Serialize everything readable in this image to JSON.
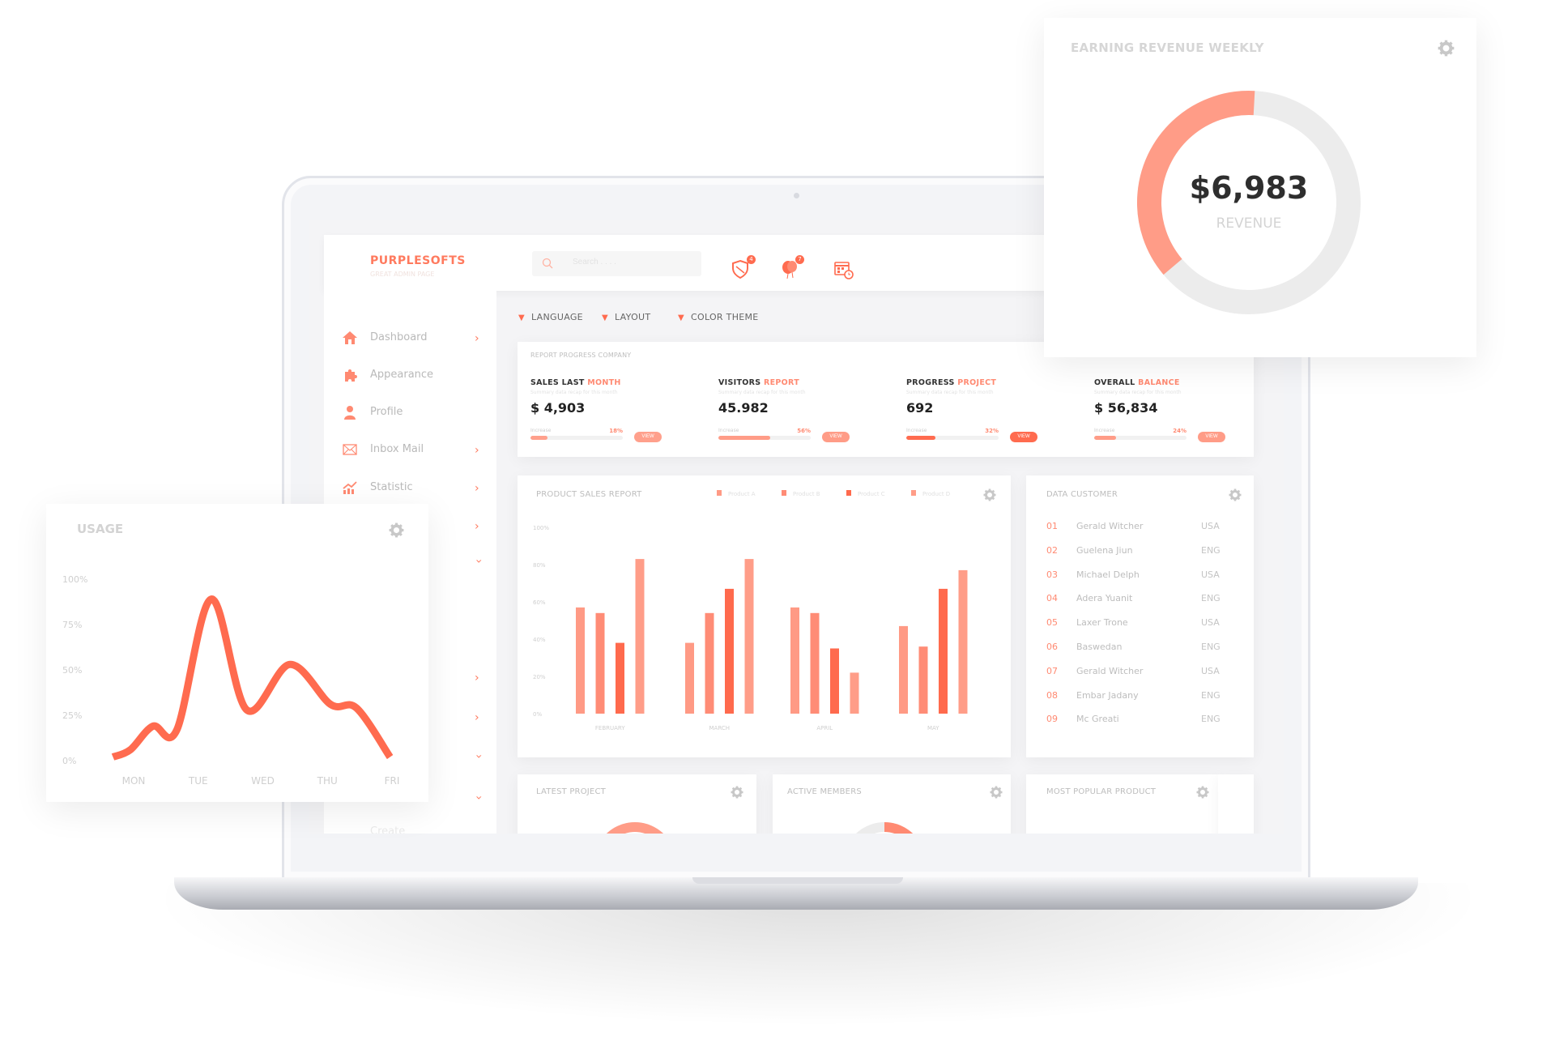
{
  "colors": {
    "accent": "#ff6b4f",
    "accent_light": "#ff9c87",
    "track": "#ececec"
  },
  "header": {
    "logo": "PURPLESOFTS",
    "logo_sub": "GREAT ADMIN PAGE",
    "search_placeholder": "Search . . . .",
    "icons": [
      {
        "name": "shield-icon",
        "badge": "4"
      },
      {
        "name": "balloon-icon",
        "badge": "7"
      },
      {
        "name": "calendar-clock-icon"
      }
    ]
  },
  "sidebar": {
    "items": [
      {
        "label": "Dashboard",
        "icon": "home-icon",
        "chevron": "right"
      },
      {
        "label": "Appearance",
        "icon": "puzzle-icon",
        "chevron": ""
      },
      {
        "label": "Profile",
        "icon": "user-icon",
        "chevron": ""
      },
      {
        "label": "Inbox Mail",
        "icon": "mail-icon",
        "chevron": "right"
      },
      {
        "label": "Statistic",
        "icon": "chart-icon",
        "chevron": "right"
      }
    ],
    "hidden_chevrons": [
      "right",
      "down",
      "right",
      "right",
      "down",
      "down"
    ],
    "bottom_label": "Create"
  },
  "filters": [
    "LANGUAGE",
    "LAYOUT",
    "COLOR THEME"
  ],
  "report": {
    "title": "REPORT PROGRESS COMPANY",
    "stats": [
      {
        "label": "SALES LAST",
        "accent": "MONTH",
        "subtitle": "Summary data recap for this month",
        "value": "$ 4,903",
        "increase_label": "Increase",
        "percent": "18%",
        "progress": 18,
        "button": "VIEW",
        "button_color": "#ffa08c"
      },
      {
        "label": "VISITORS",
        "accent": "REPORT",
        "subtitle": "Summary data recap for this month",
        "value": "45.982",
        "increase_label": "Increase",
        "percent": "56%",
        "progress": 56,
        "button": "VIEW",
        "button_color": "#ff9c87"
      },
      {
        "label": "PROGRESS",
        "accent": "PROJECT",
        "subtitle": "Summary data recap for this month",
        "value": "692",
        "increase_label": "Increase",
        "percent": "32%",
        "progress": 32,
        "button": "VIEW",
        "button_color": "#ff6b4f"
      },
      {
        "label": "OVERALL",
        "accent": "BALANCE",
        "subtitle": "Summary data recap for this month",
        "value": "$ 56,834",
        "increase_label": "Increase",
        "percent": "24%",
        "progress": 24,
        "button": "VIEW",
        "button_color": "#ff9c87"
      }
    ]
  },
  "customers": {
    "title": "DATA CUSTOMER",
    "rows": [
      {
        "no": "01",
        "name": "Gerald Witcher",
        "country": "USA"
      },
      {
        "no": "02",
        "name": "Guelena Jiun",
        "country": "ENG"
      },
      {
        "no": "03",
        "name": "Michael Delph",
        "country": "USA"
      },
      {
        "no": "04",
        "name": "Adera Yuanit",
        "country": "ENG"
      },
      {
        "no": "05",
        "name": "Laxer Trone",
        "country": "USA"
      },
      {
        "no": "06",
        "name": "Baswedan",
        "country": "ENG"
      },
      {
        "no": "07",
        "name": "Gerald Witcher",
        "country": "USA"
      },
      {
        "no": "08",
        "name": "Embar Jadany",
        "country": "ENG"
      },
      {
        "no": "09",
        "name": "Mc Greati",
        "country": "ENG"
      }
    ]
  },
  "bottom_cards": [
    {
      "title": "LATEST PROJECT"
    },
    {
      "title": "ACTIVE MEMBERS"
    },
    {
      "title": "MOST POPULAR PRODUCT"
    }
  ],
  "chart_data": [
    {
      "type": "bar",
      "title": "PRODUCT SALES REPORT",
      "categories": [
        "FEBRUARY",
        "MARCH",
        "APRIL",
        "MAY"
      ],
      "yticks": [
        "0%",
        "20%",
        "40%",
        "60%",
        "80%",
        "100%"
      ],
      "ylim": [
        0,
        100
      ],
      "legend": "top-right",
      "series": [
        {
          "name": "Product A",
          "color": "#ff9a85",
          "values": [
            57,
            38,
            57,
            47
          ]
        },
        {
          "name": "Product B",
          "color": "#ff8c76",
          "values": [
            54,
            54,
            54,
            36
          ]
        },
        {
          "name": "Product C",
          "color": "#ff6a4d",
          "values": [
            38,
            67,
            35,
            67
          ]
        },
        {
          "name": "Product D",
          "color": "#ff9d88",
          "values": [
            83,
            83,
            22,
            77
          ]
        }
      ]
    },
    {
      "type": "line",
      "title": "USAGE",
      "categories": [
        "MON",
        "TUE",
        "WED",
        "THU",
        "FRI"
      ],
      "yticks": [
        "0%",
        "25%",
        "50%",
        "75%",
        "100%"
      ],
      "ylim": [
        0,
        100
      ],
      "color": "#ff6b4f",
      "points": [
        [
          -0.32,
          2
        ],
        [
          -0.05,
          6
        ],
        [
          0.3,
          19
        ],
        [
          0.67,
          17
        ],
        [
          1.2,
          89
        ],
        [
          1.75,
          28
        ],
        [
          2.42,
          53
        ],
        [
          3.05,
          31
        ],
        [
          3.45,
          29
        ],
        [
          3.97,
          2
        ]
      ]
    },
    {
      "type": "pie",
      "title": "EARNING REVENUE WEEKLY",
      "value": "$6,983",
      "label": "REVENUE",
      "fraction": 0.37,
      "color": "#ff9c87",
      "track": "#ececec"
    }
  ]
}
